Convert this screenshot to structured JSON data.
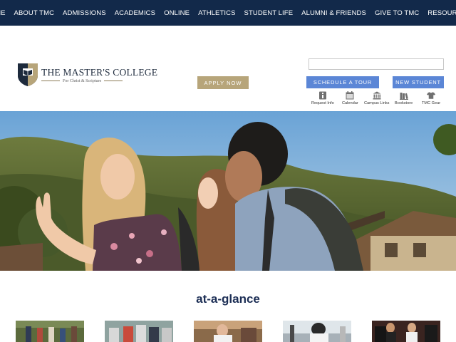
{
  "nav": {
    "items": [
      "HOME",
      "ABOUT TMC",
      "ADMISSIONS",
      "ACADEMICS",
      "ONLINE",
      "ATHLETICS",
      "STUDENT LIFE",
      "ALUMNI & FRIENDS",
      "GIVE TO TMC",
      "RESOURCES"
    ]
  },
  "logo": {
    "title": "THE MASTER'S COLLEGE",
    "tagline": "For Christ & Scripture"
  },
  "header": {
    "apply_label": "APPLY NOW",
    "search_value": "",
    "tour_label": "SCHEDULE A TOUR",
    "new_student_label": "NEW STUDENT"
  },
  "quicklinks": [
    {
      "label": "Request Info",
      "icon": "info-icon"
    },
    {
      "label": "Calendar",
      "icon": "calendar-icon"
    },
    {
      "label": "Campus Links",
      "icon": "building-icon"
    },
    {
      "label": "Bookstore",
      "icon": "books-icon"
    },
    {
      "label": "TMC Gear",
      "icon": "shirt-icon"
    }
  ],
  "glance": {
    "title": "at-a-glance"
  },
  "colors": {
    "nav_bg": "#12294a",
    "apply_bg": "#b7a57a",
    "blue_btn": "#5b86d6",
    "heading": "#1c2e55"
  }
}
